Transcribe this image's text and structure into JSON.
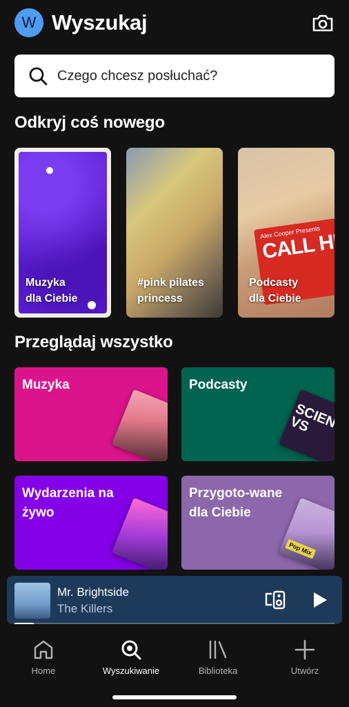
{
  "header": {
    "avatar_letter": "W",
    "title": "Wyszukaj",
    "camera_icon": "camera-icon"
  },
  "search": {
    "placeholder": "Czego chcesz posłuchać?"
  },
  "discover": {
    "title": "Odkryj coś nowego",
    "cards": [
      {
        "label_line1": "Muzyka",
        "label_line2": "dla Ciebie"
      },
      {
        "label_line1": "#pink pilates",
        "label_line2": "princess"
      },
      {
        "label_line1": "Podcasty",
        "label_line2": "dla Ciebie",
        "art_text_small": "Alex Cooper Presents",
        "art_text_big": "CALL HER DADDY"
      }
    ]
  },
  "browse": {
    "title": "Przeglądaj wszystko",
    "tiles": [
      {
        "label": "Muzyka",
        "color": "#dc148c"
      },
      {
        "label": "Podcasty",
        "color": "#006450",
        "art_text": "SCIENCE VS"
      },
      {
        "label": "Wydarzenia na żywo",
        "color": "#8400e7"
      },
      {
        "label": "Przygoto-wane dla Ciebie",
        "color": "#8d67ab",
        "art_badge": "Pop Mix"
      }
    ]
  },
  "player": {
    "song": "Mr. Brightside",
    "artist": "The Killers",
    "progress": 0.06,
    "background": "#1e3a5a"
  },
  "nav": {
    "items": [
      {
        "label": "Home",
        "icon": "home-icon"
      },
      {
        "label": "Wyszukiwanie",
        "icon": "search-icon",
        "active": true
      },
      {
        "label": "Biblioteka",
        "icon": "library-icon"
      },
      {
        "label": "Utwórz",
        "icon": "plus-icon"
      }
    ]
  }
}
